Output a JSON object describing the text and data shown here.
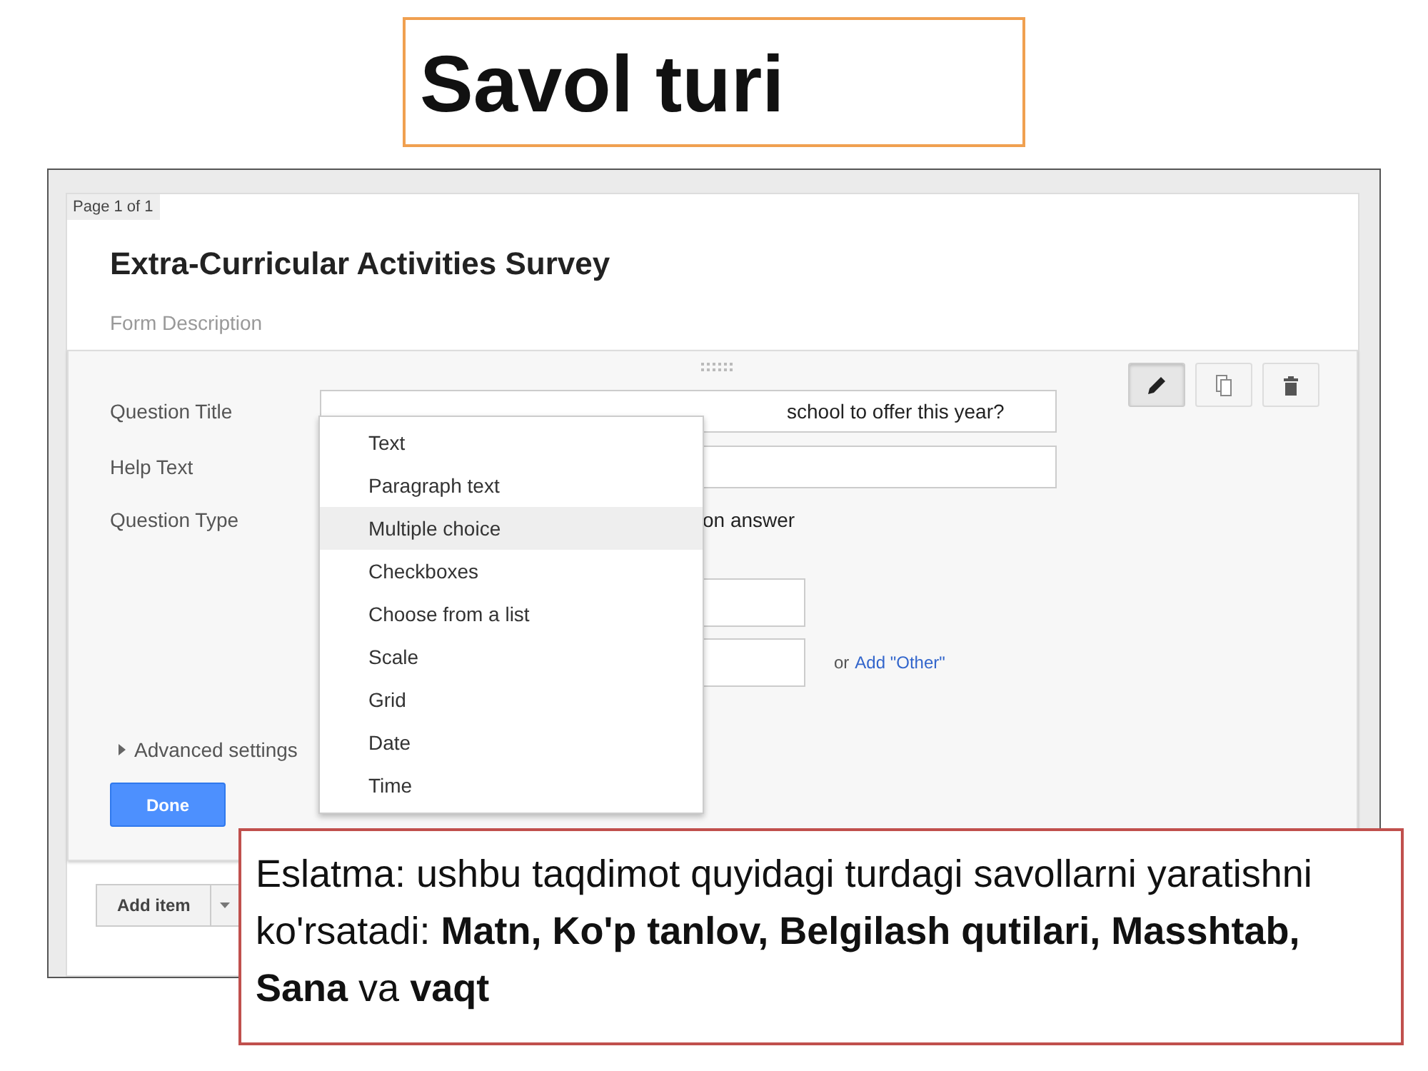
{
  "slide_title": "Savol turi",
  "form": {
    "page_label": "Page 1 of 1",
    "title": "Extra-Curricular Activities Survey",
    "description_placeholder": "Form Description"
  },
  "question": {
    "tools": [
      {
        "kind": "edit",
        "selected": true
      },
      {
        "kind": "duplicate",
        "selected": false
      },
      {
        "kind": "delete",
        "selected": false
      }
    ],
    "fields": [
      {
        "label": "Question Title",
        "value": "school to offer this year?"
      },
      {
        "label": "Help Text"
      }
    ],
    "type_label": "Question Type",
    "type_value": "on answer",
    "other_prefix": "or",
    "other_link": "Add \"Other\"",
    "advanced": "Advanced settings",
    "done": "Done"
  },
  "type_menu": [
    {
      "label": "Text",
      "selected": false
    },
    {
      "label": "Paragraph text",
      "selected": false
    },
    {
      "label": "Multiple choice",
      "selected": true
    },
    {
      "label": "Checkboxes",
      "selected": false
    },
    {
      "label": "Choose from a list",
      "selected": false
    },
    {
      "label": "Scale",
      "selected": false
    },
    {
      "label": "Grid",
      "selected": false
    },
    {
      "label": "Date",
      "selected": false
    },
    {
      "label": "Time",
      "selected": false
    }
  ],
  "add_item": "Add item",
  "note": "Eslatma: ushbu taqdimot quyidagi turdagi savollarni yaratishni ko'rsatadi: **Matn, Ko'p tanlov, Belgilash qutilari, Masshtab, Sana** va **vaqt**"
}
